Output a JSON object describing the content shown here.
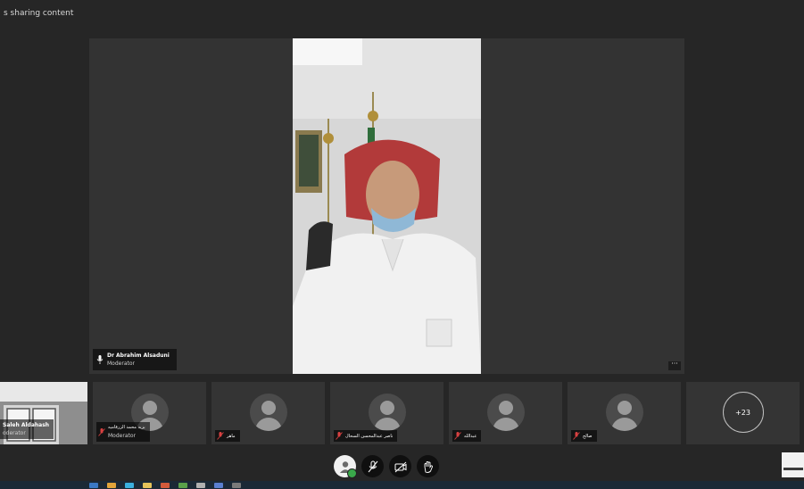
{
  "status": {
    "text": "s sharing content"
  },
  "stage": {
    "presenter_name": "Dr Abrahim Alsaduni",
    "presenter_role": "Moderator"
  },
  "participants": [
    {
      "name": "Saleh Aldahash",
      "role": "oderator",
      "type": "video"
    },
    {
      "name": "بزيه محمد الزرقاميه",
      "role": "Moderator",
      "type": "avatar"
    },
    {
      "name": "ماهر",
      "type": "avatar"
    },
    {
      "name": "ناصر عبدالمحسن السحال",
      "type": "avatar"
    },
    {
      "name": "عبدالله",
      "type": "avatar"
    },
    {
      "name": "صالح",
      "type": "avatar"
    },
    {
      "more_label": "+23",
      "type": "more"
    }
  ],
  "icons": {
    "mic": "microphone-icon",
    "mic_muted": "microphone-muted-icon",
    "more": "ellipsis-icon",
    "user": "user-icon",
    "camera_off": "camera-off-icon",
    "raise_hand": "hand-icon"
  },
  "colors": {
    "background": "#262626",
    "tile": "#343434",
    "muted_red": "#d94141",
    "online_green": "#3aa84a"
  }
}
